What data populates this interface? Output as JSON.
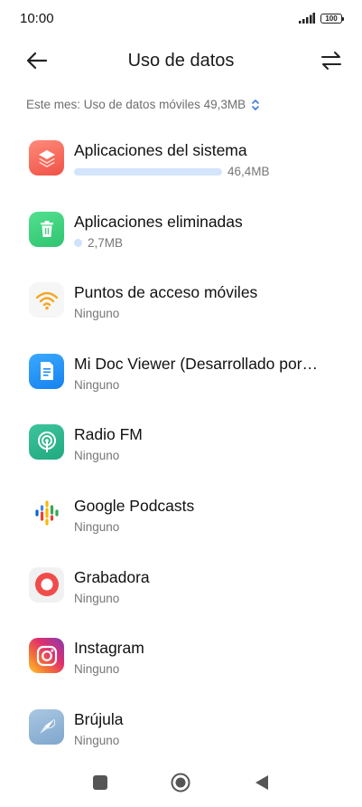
{
  "status": {
    "time": "10:00",
    "battery": "100"
  },
  "header": {
    "title": "Uso de datos"
  },
  "period": {
    "label": "Este mes: Uso de datos móviles 49,3MB"
  },
  "apps": [
    {
      "name": "Aplicaciones del sistema",
      "usage": "46,4MB",
      "usage_fraction": 0.94,
      "icon": "layers-icon"
    },
    {
      "name": "Aplicaciones eliminadas",
      "usage": "2,7MB",
      "icon": "trash-icon"
    },
    {
      "name": "Puntos de acceso móviles",
      "usage": "Ninguno",
      "icon": "wifi-hotspot-icon"
    },
    {
      "name": "Mi Doc Viewer (Desarrollado por…",
      "usage": "Ninguno",
      "icon": "document-icon"
    },
    {
      "name": "Radio FM",
      "usage": "Ninguno",
      "icon": "radio-icon"
    },
    {
      "name": "Google Podcasts",
      "usage": "Ninguno",
      "icon": "podcasts-icon"
    },
    {
      "name": "Grabadora",
      "usage": "Ninguno",
      "icon": "recorder-icon"
    },
    {
      "name": "Instagram",
      "usage": "Ninguno",
      "icon": "instagram-icon"
    },
    {
      "name": "Brújula",
      "usage": "Ninguno",
      "icon": "compass-icon"
    }
  ],
  "colors": {
    "accent_bar": "#d3e5fb",
    "system_icon": "#f4675f",
    "trash_icon": "#3dcf7d"
  }
}
